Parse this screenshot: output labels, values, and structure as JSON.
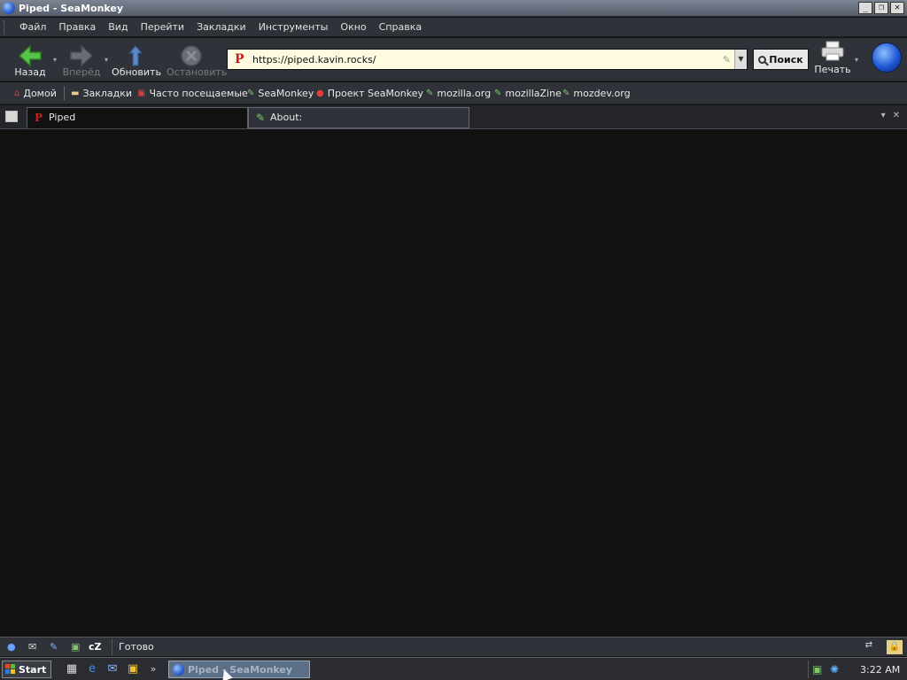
{
  "window": {
    "title": "Piped - SeaMonkey",
    "controls": [
      "_",
      "❐",
      "✕"
    ]
  },
  "menu": [
    "Файл",
    "Правка",
    "Вид",
    "Перейти",
    "Закладки",
    "Инструменты",
    "Окно",
    "Справка"
  ],
  "nav": {
    "back": "Назад",
    "forward": "Вперёд",
    "reload": "Обновить",
    "stop": "Остановить",
    "print": "Печать",
    "search": "Поиск"
  },
  "urlbar": {
    "site_icon": "P",
    "url": "https://piped.kavin.rocks/"
  },
  "bookmarks": [
    {
      "label": "Домой",
      "icon": "home-icon"
    },
    {
      "label": "Закладки",
      "icon": "folder-icon"
    },
    {
      "label": "Часто посещаемые",
      "icon": "history-icon"
    },
    {
      "label": "SeaMonkey",
      "icon": "link-icon"
    },
    {
      "label": "Проект SeaMonkey",
      "icon": "seamonkey-icon"
    },
    {
      "label": "mozilla.org",
      "icon": "link-icon"
    },
    {
      "label": "mozillaZine",
      "icon": "link-icon"
    },
    {
      "label": "mozdev.org",
      "icon": "link-icon"
    }
  ],
  "tabs": [
    {
      "label": "Piped",
      "icon": "P",
      "active": true
    },
    {
      "label": "About:",
      "icon": "link-icon",
      "active": false
    }
  ],
  "status": {
    "text": "Готово",
    "chatzilla": "cZ"
  },
  "taskbar": {
    "start": "Start",
    "task_item": "Piped - SeaMonkey",
    "clock": "3:22 AM"
  },
  "colors": {
    "accent_green": "#57c24b",
    "piped_red": "#c21f1f",
    "background": "#111112"
  }
}
